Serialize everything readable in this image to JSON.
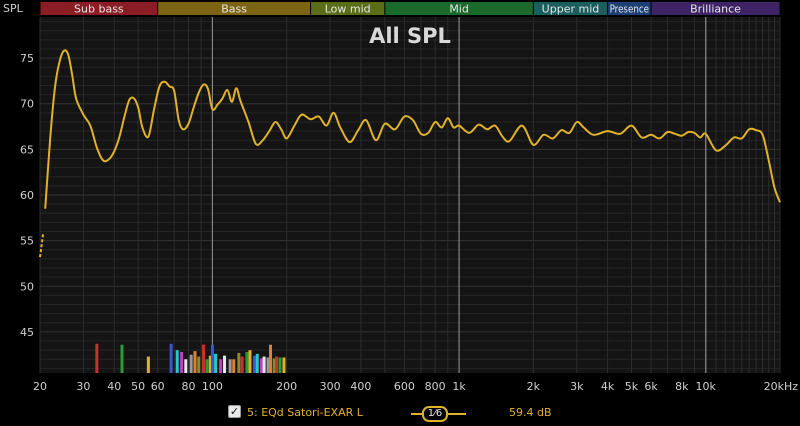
{
  "chart_data": {
    "type": "line",
    "title": "All SPL",
    "ylabel": "SPL",
    "x_scale": "log",
    "xlim": [
      20,
      20000
    ],
    "ylim": [
      40.5,
      79.5
    ],
    "grid": true,
    "x_ticks": [
      20,
      30,
      40,
      50,
      60,
      80,
      100,
      200,
      300,
      400,
      600,
      800,
      1000,
      2000,
      3000,
      4000,
      5000,
      6000,
      8000,
      10000,
      20000
    ],
    "x_tick_labels": [
      "20",
      "30",
      "40",
      "50",
      "60",
      "80",
      "100",
      "200",
      "300",
      "400",
      "600",
      "800",
      "1k",
      "2k",
      "3k",
      "4k",
      "5k",
      "6k",
      "8k",
      "10k",
      "20kHz"
    ],
    "y_ticks": [
      45,
      50,
      55,
      60,
      65,
      70,
      75
    ],
    "frequency_bands": [
      {
        "name": "Sub bass",
        "from": 20,
        "to": 60,
        "color": "#8b1e24"
      },
      {
        "name": "Bass",
        "from": 60,
        "to": 250,
        "color": "#7d6414"
      },
      {
        "name": "Low mid",
        "from": 250,
        "to": 500,
        "color": "#5a6e18"
      },
      {
        "name": "Mid",
        "from": 500,
        "to": 2000,
        "color": "#1a6a2c"
      },
      {
        "name": "Upper mid",
        "from": 2000,
        "to": 4000,
        "color": "#1a5e5e"
      },
      {
        "name": "Presence",
        "from": 4000,
        "to": 6000,
        "color": "#1d3f76"
      },
      {
        "name": "Brilliance",
        "from": 6000,
        "to": 20000,
        "color": "#3e2466"
      }
    ],
    "series": [
      {
        "name": "5: EQd Satori-EXAR L",
        "color": "#e0b22a",
        "x": [
          21,
          22,
          23,
          24,
          25,
          26,
          27,
          28,
          30,
          32,
          34,
          36,
          38,
          40,
          42,
          44,
          46,
          48,
          50,
          52,
          55,
          58,
          61,
          64,
          67,
          70,
          73,
          76,
          80,
          84,
          88,
          92,
          96,
          100,
          105,
          110,
          115,
          120,
          125,
          130,
          140,
          150,
          160,
          170,
          180,
          190,
          200,
          215,
          230,
          250,
          270,
          290,
          310,
          330,
          360,
          390,
          420,
          460,
          500,
          550,
          600,
          650,
          700,
          750,
          800,
          850,
          900,
          950,
          1000,
          1100,
          1200,
          1300,
          1400,
          1500,
          1600,
          1800,
          2000,
          2200,
          2400,
          2600,
          2800,
          3000,
          3200,
          3500,
          4000,
          4500,
          5000,
          5500,
          6000,
          6500,
          7000,
          7500,
          8000,
          8500,
          9000,
          9500,
          10000,
          11000,
          12000,
          13000,
          14000,
          15000,
          16000,
          17000,
          18000,
          19000,
          20000
        ],
        "y": [
          58.5,
          66.2,
          71.8,
          74.6,
          75.8,
          75.4,
          73.2,
          70.6,
          68.8,
          67.6,
          65.2,
          63.8,
          63.9,
          64.8,
          66.4,
          68.6,
          70.4,
          70.6,
          69.6,
          67.4,
          66.4,
          69.4,
          71.9,
          72.4,
          71.9,
          71.4,
          68.2,
          67.2,
          67.8,
          69.6,
          71.2,
          72.1,
          71.6,
          69.4,
          69.9,
          70.6,
          71.5,
          70.2,
          71.7,
          70.3,
          68.0,
          65.6,
          66.0,
          67.0,
          68.0,
          67.2,
          66.2,
          67.6,
          68.8,
          68.3,
          68.6,
          67.6,
          69.0,
          67.4,
          65.8,
          67.1,
          68.2,
          66.0,
          67.8,
          67.2,
          68.6,
          68.2,
          66.7,
          66.8,
          68.0,
          67.4,
          68.4,
          67.4,
          67.6,
          66.8,
          67.7,
          67.2,
          67.6,
          66.4,
          65.9,
          67.6,
          65.5,
          66.6,
          66.2,
          67.1,
          66.8,
          68.0,
          67.4,
          66.6,
          67.0,
          66.7,
          67.6,
          66.3,
          66.6,
          66.2,
          66.9,
          66.7,
          66.5,
          66.9,
          66.8,
          66.3,
          66.7,
          64.9,
          65.4,
          66.3,
          66.2,
          67.2,
          67.1,
          66.6,
          63.8,
          60.8,
          59.2
        ],
        "x_prefix": [
          20,
          20.3,
          20.6
        ],
        "y_prefix": [
          53.2,
          54.5,
          55.8
        ]
      }
    ],
    "eq_filter_bars": {
      "colors": [
        "#c83030",
        "#2a9a3a",
        "#e0b22a",
        "#3a56d0",
        "#28c8c8",
        "#c040c0",
        "#e8e8e8",
        "#9a9a9a",
        "#e08030",
        "#8a8a30"
      ],
      "freqs": [
        34,
        43,
        55,
        68,
        72,
        75,
        78,
        82,
        85,
        88,
        92,
        95,
        98,
        100,
        103,
        108,
        112,
        118,
        122,
        128,
        132,
        138,
        142,
        148,
        152,
        158,
        162,
        168,
        172,
        178,
        182,
        188,
        195
      ],
      "levels_db": [
        43.7,
        43.6,
        42.3,
        43.7,
        43.0,
        42.8,
        42.0,
        42.5,
        42.9,
        42.3,
        43.6,
        42.0,
        42.4,
        43.6,
        42.6,
        42.0,
        42.4,
        42.0,
        42.0,
        42.7,
        42.3,
        42.8,
        43.0,
        42.4,
        42.6,
        42.1,
        42.3,
        42.2,
        43.6,
        42.1,
        42.3,
        42.2,
        42.2
      ]
    }
  },
  "legend": {
    "checked": true,
    "series_label": "5: EQd Satori-EXAR L",
    "smoothing_label": "1⁄6",
    "level_label": "59.4 dB"
  }
}
